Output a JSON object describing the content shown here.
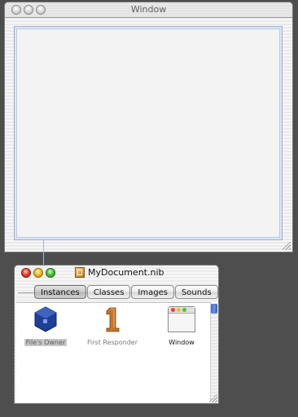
{
  "window": {
    "title": "Window",
    "buttons": [
      "close-button",
      "minimize-button",
      "zoom-button"
    ]
  },
  "nib": {
    "title": "MyDocument.nib",
    "tabs": [
      "Instances",
      "Classes",
      "Images",
      "Sounds"
    ],
    "selected_tab": "Instances",
    "items": {
      "owner": "File's Owner",
      "responder": "First Responder",
      "window": "Window"
    }
  },
  "colors": {
    "owner_icon": "#1e3f96",
    "responder_icon": "#c8742a",
    "scroll_thumb": "#3a67c8"
  }
}
